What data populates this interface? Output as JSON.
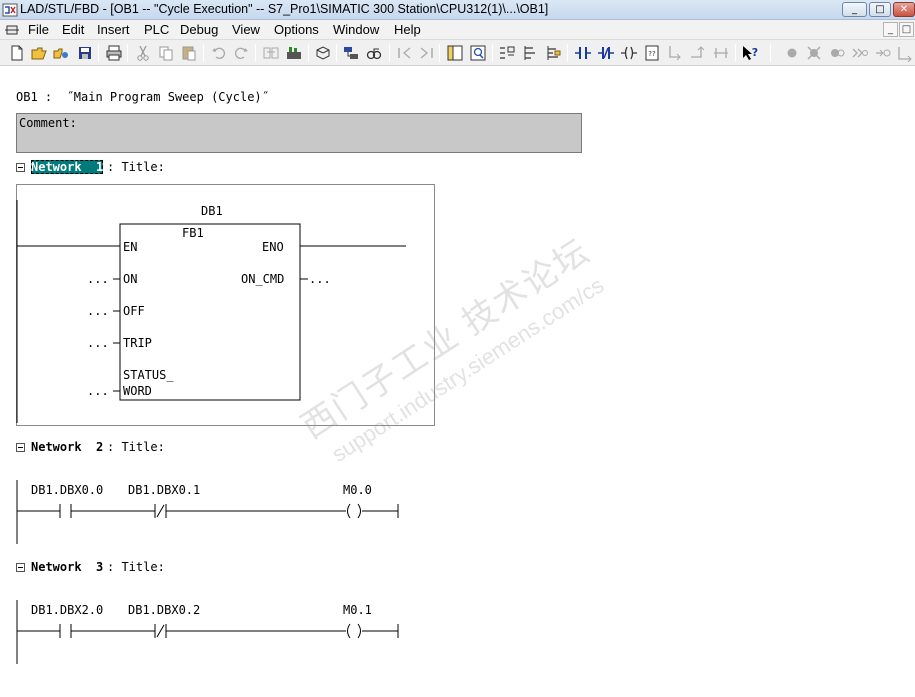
{
  "window": {
    "title": "LAD/STL/FBD  - [OB1 -- \"Cycle Execution\" -- S7_Pro1\\SIMATIC 300 Station\\CPU312(1)\\...\\OB1]",
    "controls": {
      "minimize": "_",
      "maximize": "□",
      "close": "✕"
    }
  },
  "menu": {
    "items": [
      "File",
      "Edit",
      "Insert",
      "PLC",
      "Debug",
      "View",
      "Options",
      "Window",
      "Help"
    ],
    "mdi_minimize": "_",
    "mdi_restore": "□"
  },
  "toolbar": {
    "icons": [
      "new-icon",
      "open-icon",
      "online-icon",
      "save-icon",
      "print-icon",
      "cut-icon",
      "copy-icon",
      "paste-icon",
      "undo-icon",
      "redo-icon",
      "load-icon",
      "download-icon",
      "window-icon",
      "accessible-nodes-icon",
      "monitor-icon",
      "first-network-icon",
      "last-network-icon",
      "overview-icon",
      "detail-icon",
      "branch-open-icon",
      "branch-close-icon",
      "new-network-icon",
      "no-contact-icon",
      "nc-contact-icon",
      "coil-icon",
      "empty-box-icon",
      "open-branch-icon",
      "close-branch-icon",
      "connection-icon",
      "help-icon"
    ]
  },
  "editor": {
    "ob_header": "OB1 :  ˝Main Program Sweep (Cycle)˝",
    "comment_label": "Comment:",
    "networks": [
      {
        "label": "Network  1",
        "title_text": ": Title:",
        "instance_db": "DB1",
        "block_name": "FB1",
        "inputs": [
          "EN",
          "ON",
          "OFF",
          "TRIP",
          "STATUS_",
          "WORD"
        ],
        "output_eno": "ENO",
        "output_on_cmd": "ON_CMD",
        "dots": "..."
      },
      {
        "label": "Network  2",
        "title_text": ": Title:",
        "contact1": "DB1.DBX0.0",
        "contact2": "DB1.DBX0.1",
        "coil": "M0.0"
      },
      {
        "label": "Network  3",
        "title_text": ": Title:",
        "contact1": "DB1.DBX2.0",
        "contact2": "DB1.DBX0.2",
        "coil": "M0.1"
      }
    ]
  },
  "watermark": {
    "line1": "西门子工业   技术论坛",
    "line2": "support.industry.siemens.com/cs"
  }
}
